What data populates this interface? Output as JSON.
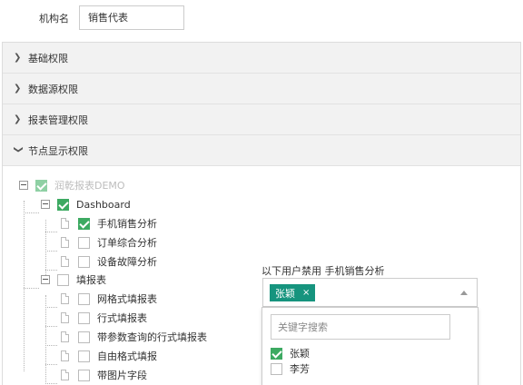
{
  "org": {
    "label": "机构名",
    "value": "销售代表"
  },
  "accordion": [
    {
      "label": "基础权限",
      "expanded": false
    },
    {
      "label": "数据源权限",
      "expanded": false
    },
    {
      "label": "报表管理权限",
      "expanded": false
    },
    {
      "label": "节点显示权限",
      "expanded": true
    }
  ],
  "tree": {
    "root": {
      "label": "润乾报表DEMO",
      "checked": true
    },
    "dashboard": {
      "label": "Dashboard",
      "checked": true
    },
    "dashboard_items": [
      {
        "label": "手机销售分析",
        "checked": true
      },
      {
        "label": "订单综合分析",
        "checked": false
      },
      {
        "label": "设备故障分析",
        "checked": false
      }
    ],
    "fill": {
      "label": "填报表",
      "checked": false
    },
    "fill_items": [
      {
        "label": "网格式填报表",
        "checked": false
      },
      {
        "label": "行式填报表",
        "checked": false
      },
      {
        "label": "带参数查询的行式填报表",
        "checked": false
      },
      {
        "label": "自由格式填报",
        "checked": false
      },
      {
        "label": "带图片字段",
        "checked": false
      }
    ]
  },
  "ban": {
    "title": "以下用户禁用 手机销售分析",
    "selected_tag": "张颖",
    "remove_icon": "×",
    "search_placeholder": "关键字搜索",
    "options": [
      {
        "label": "张颖",
        "checked": true
      },
      {
        "label": "李芳",
        "checked": false
      }
    ]
  },
  "colors": {
    "check_green": "#3daa62",
    "tag_teal": "#16947e"
  }
}
